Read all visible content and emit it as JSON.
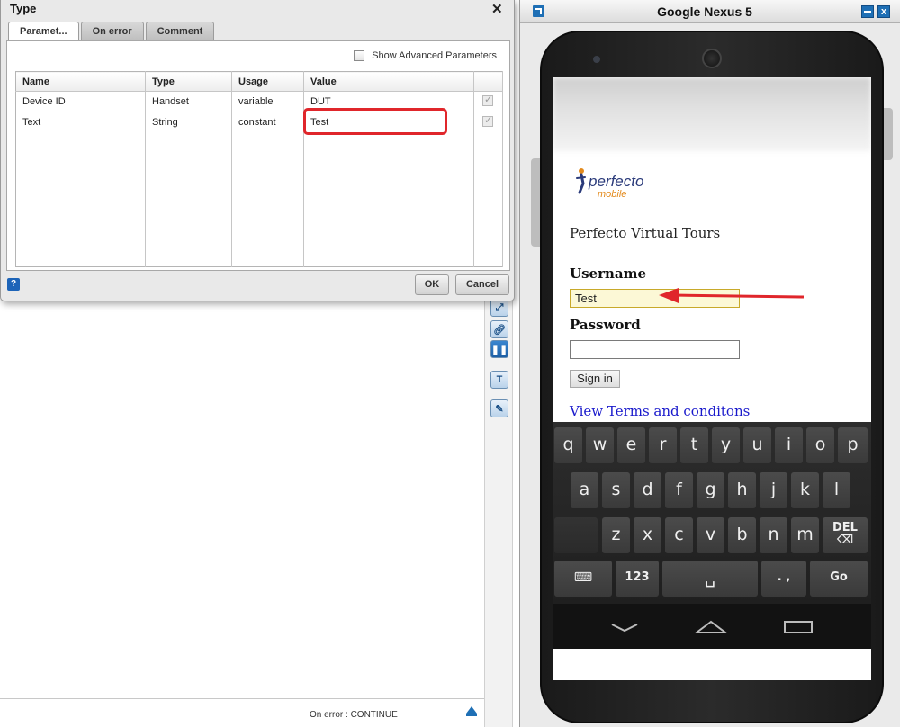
{
  "dialog": {
    "title": "Type",
    "close_glyph": "✕",
    "tabs": [
      "Paramet...",
      "On error",
      "Comment"
    ],
    "advanced_label": "Show Advanced Parameters",
    "columns": [
      "Name",
      "Type",
      "Usage",
      "Value"
    ],
    "rows": [
      {
        "name": "Device ID",
        "type": "Handset",
        "usage": "variable",
        "value": "DUT"
      },
      {
        "name": "Text",
        "type": "String",
        "usage": "constant",
        "value": "Test"
      }
    ],
    "help_glyph": "?",
    "ok_label": "OK",
    "cancel_label": "Cancel"
  },
  "workspace": {
    "status_text": "On error : CONTINUE"
  },
  "device": {
    "title": "Google Nexus 5",
    "close_glyph": "x",
    "site_title": "Perfecto Virtual Tours",
    "logo_brand": "perfecto",
    "logo_sub": "mobile",
    "username_label": "Username",
    "username_value": "Test",
    "password_label": "Password",
    "signin_label": "Sign in",
    "terms_link": "View Terms and conditons",
    "keyboard": {
      "row1": [
        "q",
        "w",
        "e",
        "r",
        "t",
        "y",
        "u",
        "i",
        "o",
        "p"
      ],
      "row2": [
        "a",
        "s",
        "d",
        "f",
        "g",
        "h",
        "j",
        "k",
        "l"
      ],
      "row3": [
        "z",
        "x",
        "c",
        "v",
        "b",
        "n",
        "m"
      ],
      "del_label": "DEL",
      "num_label": "123",
      "punct_label": ". ,",
      "go_label": "Go"
    }
  },
  "colors": {
    "highlight": "#e0262b",
    "accent": "#1e6fb5",
    "link": "#1a1acc"
  }
}
